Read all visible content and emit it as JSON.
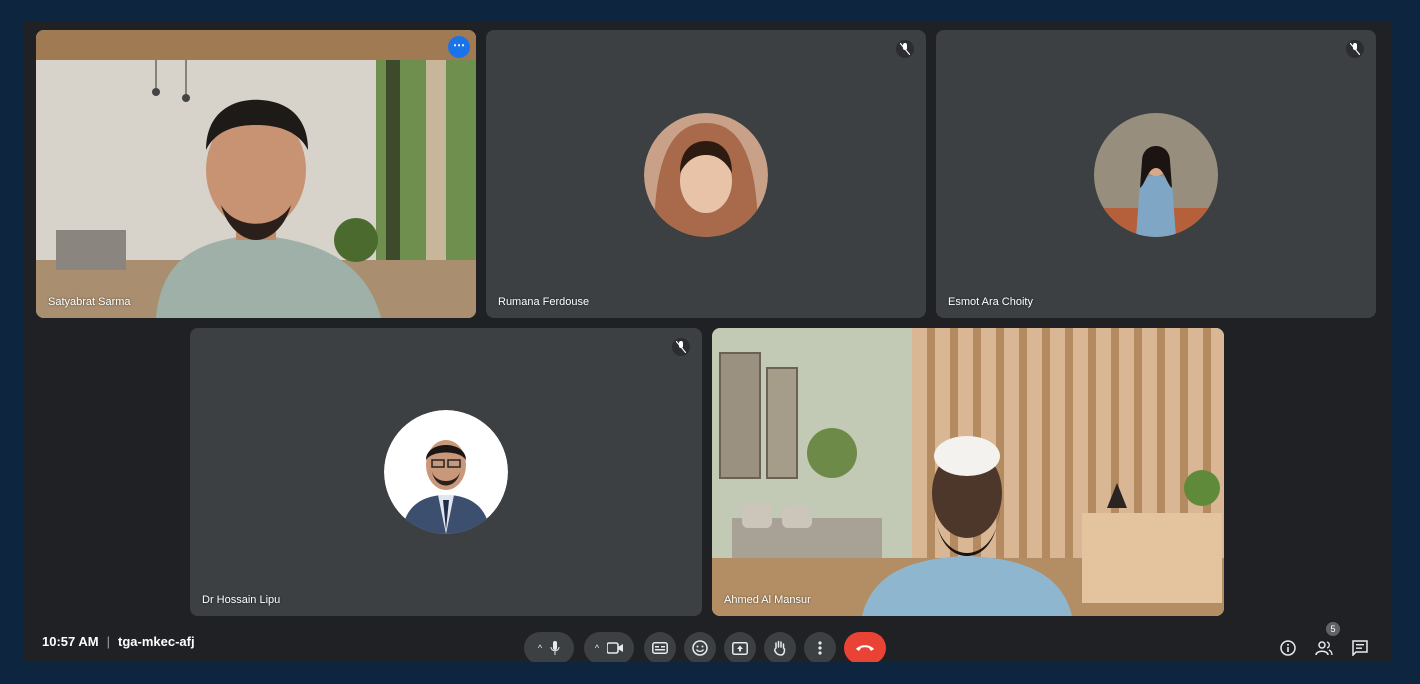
{
  "meeting": {
    "time": "10:57 AM",
    "separator": "|",
    "code": "tga-mkec-afj"
  },
  "participants": [
    {
      "name": "Satyabrat Sarma",
      "type": "video",
      "active": true
    },
    {
      "name": "Rumana Ferdouse",
      "type": "avatar",
      "muted": true
    },
    {
      "name": "Esmot Ara Choity",
      "type": "avatar",
      "muted": true
    },
    {
      "name": "Dr Hossain Lipu",
      "type": "avatar",
      "muted": true
    },
    {
      "name": "Ahmed Al Mansur",
      "type": "video"
    }
  ],
  "participant_count": "5",
  "icons": {
    "mic": "microphone-icon",
    "camera": "camera-icon",
    "captions": "captions-icon",
    "emoji": "emoji-icon",
    "present": "present-screen-icon",
    "hand": "raise-hand-icon",
    "more": "more-options-icon",
    "end": "end-call-icon",
    "info": "info-icon",
    "people": "people-icon",
    "chat": "chat-icon"
  },
  "colors": {
    "background": "#202124",
    "tile": "#3c4043",
    "active_outline": "#8ab4f8",
    "end_call": "#ea4335"
  }
}
